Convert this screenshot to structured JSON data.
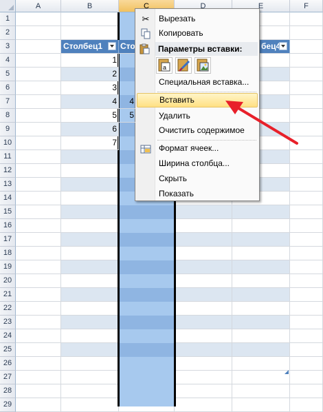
{
  "columns": [
    "A",
    "B",
    "C",
    "D",
    "E",
    "F"
  ],
  "selected_column": "C",
  "rows": [
    "1",
    "2",
    "3",
    "4",
    "5",
    "6",
    "7",
    "8",
    "9",
    "10",
    "11",
    "12",
    "13",
    "14",
    "15",
    "16",
    "17",
    "18",
    "19",
    "20",
    "21",
    "22",
    "23",
    "24",
    "25",
    "26",
    "27",
    "28",
    "29"
  ],
  "table": {
    "headers": [
      "Столбец1",
      "Сто",
      "",
      "бец4"
    ],
    "col_b_values": [
      "1",
      "2",
      "3",
      "4",
      "5",
      "6",
      "7"
    ],
    "col_c_partial": [
      "4",
      "5"
    ]
  },
  "context_menu": {
    "items": {
      "cut": "Вырезать",
      "copy": "Копировать",
      "paste_options_title": "Параметры вставки:",
      "paste_special": "Специальная вставка...",
      "insert": "Вставить",
      "delete": "Удалить",
      "clear_contents": "Очистить содержимое",
      "format_cells": "Формат ячеек...",
      "column_width": "Ширина столбца...",
      "hide": "Скрыть",
      "show": "Показать"
    },
    "highlighted": "insert"
  },
  "colors": {
    "table_header": "#4f81bd",
    "band": "#dce6f1",
    "selection": "#a7c9ee",
    "arrow": "#e8202a"
  }
}
